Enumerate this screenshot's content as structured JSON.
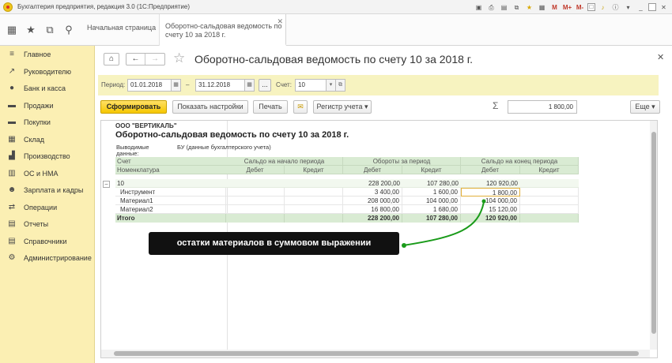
{
  "window": {
    "title": "Бухгалтерия предприятия, редакция 3.0  (1С:Предприятие)",
    "tool_labels": [
      "M",
      "M+",
      "M-"
    ]
  },
  "tabs": [
    {
      "label": "Начальная страница"
    },
    {
      "label": "Оборотно-сальдовая ведомость по счету 10 за 2018 г."
    }
  ],
  "sidebar": {
    "items": [
      {
        "label": "Главное",
        "icon": "menu-icon"
      },
      {
        "label": "Руководителю",
        "icon": "chart-icon"
      },
      {
        "label": "Банк и касса",
        "icon": "coins-icon"
      },
      {
        "label": "Продажи",
        "icon": "basket-icon"
      },
      {
        "label": "Покупки",
        "icon": "cart-icon"
      },
      {
        "label": "Склад",
        "icon": "warehouse-icon"
      },
      {
        "label": "Производство",
        "icon": "factory-icon"
      },
      {
        "label": "ОС и НМА",
        "icon": "building-icon"
      },
      {
        "label": "Зарплата и кадры",
        "icon": "people-icon"
      },
      {
        "label": "Операции",
        "icon": "operations-icon"
      },
      {
        "label": "Отчеты",
        "icon": "reports-icon"
      },
      {
        "label": "Справочники",
        "icon": "book-icon"
      },
      {
        "label": "Администрирование",
        "icon": "gear-icon"
      }
    ]
  },
  "page": {
    "title": "Оборотно-сальдовая ведомость по счету 10 за 2018 г."
  },
  "period": {
    "label": "Период:",
    "from": "01.01.2018",
    "dash": "–",
    "to": "31.12.2018",
    "dots": "...",
    "account_label": "Счет:",
    "account": "10"
  },
  "toolbar": {
    "generate": "Сформировать",
    "show_settings": "Показать настройки",
    "print": "Печать",
    "register": "Регистр учета",
    "sum": "1 800,00",
    "more": "Еще"
  },
  "report": {
    "org": "ООО \"ВЕРТИКАЛЬ\"",
    "title": "Оборотно-сальдовая ведомость по счету 10 за 2018 г.",
    "data_label_1": "Выводимые",
    "data_label_2": "данные:",
    "data_value": "БУ (данные бухгалтерского учета)",
    "headers": {
      "account": "Счет",
      "item": "Номенклатура",
      "opening": "Сальдо на начало периода",
      "turnover": "Обороты за период",
      "closing": "Сальдо на конец периода",
      "debit": "Дебет",
      "credit": "Кредит"
    },
    "group": {
      "label": "10",
      "turnover_debit": "228 200,00",
      "turnover_credit": "107 280,00",
      "closing_debit": "120 920,00"
    },
    "rows": [
      {
        "name": "Инструмент",
        "turnover_debit": "3 400,00",
        "turnover_credit": "1 600,00",
        "closing_debit": "1 800,00"
      },
      {
        "name": "Материал1",
        "turnover_debit": "208 000,00",
        "turnover_credit": "104 000,00",
        "closing_debit": "104 000,00"
      },
      {
        "name": "Материал2",
        "turnover_debit": "16 800,00",
        "turnover_credit": "1 680,00",
        "closing_debit": "15 120,00"
      }
    ],
    "total": {
      "label": "Итого",
      "turnover_debit": "228 200,00",
      "turnover_credit": "107 280,00",
      "closing_debit": "120 920,00"
    }
  },
  "annotation": "остатки материалов в суммовом выражении",
  "colors": {
    "sidebar": "#fbefb3",
    "header_green": "#d9ebd3",
    "accent_yellow": "#f6c700",
    "annotation_arrow": "#1a9b1a"
  }
}
